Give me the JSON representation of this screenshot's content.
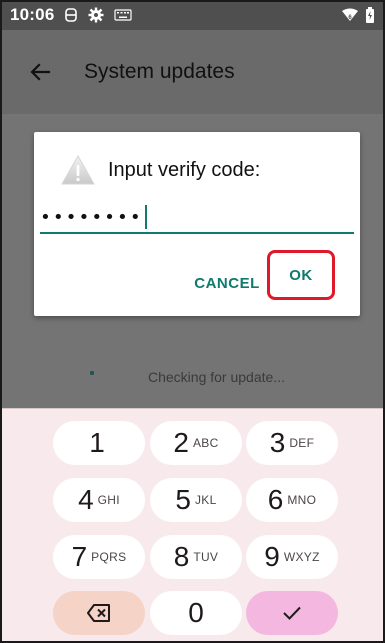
{
  "status_bar": {
    "time": "10:06",
    "left_icons": [
      "sim-icon",
      "gear-icon",
      "keyboard-icon"
    ],
    "right_icons": [
      "wifi-icon",
      "battery-icon"
    ]
  },
  "app_bar": {
    "back_icon": "arrow-back-icon",
    "title": "System updates"
  },
  "background": {
    "status_text": "Checking for update..."
  },
  "dialog": {
    "icon": "warning-icon",
    "title": "Input verify code:",
    "input_value": "••••••••",
    "cancel_label": "CANCEL",
    "ok_label": "OK"
  },
  "keypad": {
    "keys": [
      {
        "num": "1",
        "letters": ""
      },
      {
        "num": "2",
        "letters": "ABC"
      },
      {
        "num": "3",
        "letters": "DEF"
      },
      {
        "num": "4",
        "letters": "GHI"
      },
      {
        "num": "5",
        "letters": "JKL"
      },
      {
        "num": "6",
        "letters": "MNO"
      },
      {
        "num": "7",
        "letters": "PQRS"
      },
      {
        "num": "8",
        "letters": "TUV"
      },
      {
        "num": "9",
        "letters": "WXYZ"
      },
      {
        "num": "0",
        "letters": ""
      }
    ],
    "backspace_icon": "backspace-icon",
    "done_icon": "checkmark-icon"
  },
  "colors": {
    "accent": "#0f7a6d",
    "highlight_box": "#e0192a",
    "keypad_bg": "#f7e9ec",
    "backspace_key": "#f6d3c7",
    "done_key": "#f4b7e0"
  }
}
